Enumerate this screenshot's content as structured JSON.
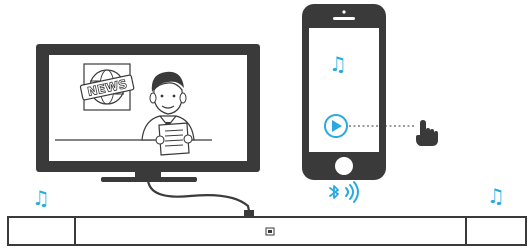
{
  "tv": {
    "news_sign": "NEWS"
  },
  "phone": {
    "note_glyph": "♫",
    "play_icon": "play-icon",
    "hand_icon": "pointing-hand-icon"
  },
  "soundbar": {
    "left_note_glyph": "♫",
    "right_note_glyph": "♫"
  },
  "bluetooth": {
    "icon": "bluetooth-icon",
    "waves_icon": "sound-waves-icon"
  },
  "colors": {
    "outline": "#3a3a3a",
    "accent": "#29a9e0",
    "screen_bg": "#ffffff"
  }
}
